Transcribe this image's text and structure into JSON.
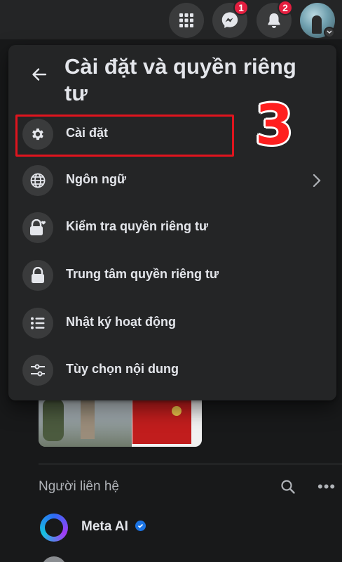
{
  "topbar": {
    "menu_icon": "grid-icon",
    "messenger_icon": "messenger-icon",
    "messenger_badge": "1",
    "notifications_icon": "bell-icon",
    "notifications_badge": "2"
  },
  "panel": {
    "title": "Cài đặt và quyền riêng tư",
    "items": [
      {
        "label": "Cài đặt",
        "icon": "gear-icon"
      },
      {
        "label": "Ngôn ngữ",
        "icon": "globe-icon"
      },
      {
        "label": "Kiểm tra quyền riêng tư",
        "icon": "lock-heart-icon"
      },
      {
        "label": "Trung tâm quyền riêng tư",
        "icon": "lock-icon"
      },
      {
        "label": "Nhật ký hoạt động",
        "icon": "list-icon"
      },
      {
        "label": "Tùy chọn nội dung",
        "icon": "sliders-icon"
      }
    ]
  },
  "annotation": {
    "step": "3"
  },
  "contacts": {
    "title": "Người liên hệ",
    "items": [
      {
        "name": "Meta AI",
        "verified": true
      }
    ]
  },
  "colors": {
    "background": "#18191a",
    "surface": "#242526",
    "icon_bg": "#3a3b3c",
    "badge": "#e41e3f",
    "highlight": "#e0141e",
    "verified": "#1b74e4"
  }
}
